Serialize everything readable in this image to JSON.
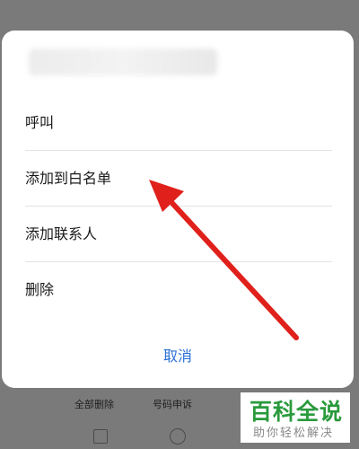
{
  "dialog": {
    "title_blurred": "",
    "items": [
      {
        "label": "呼叫"
      },
      {
        "label": "添加到白名单"
      },
      {
        "label": "添加联系人"
      },
      {
        "label": "删除"
      }
    ],
    "cancel_label": "取消"
  },
  "background": {
    "toolbar": [
      {
        "label": "全部删除"
      },
      {
        "label": "号码申诉"
      }
    ]
  },
  "watermark": {
    "title": "百科全说",
    "subtitle": "助你轻松解决"
  },
  "colors": {
    "accent": "#2b6fd6",
    "arrow": "#e0201b",
    "watermark_green": "#2a9a3c",
    "overlay": "#7a7a7a"
  }
}
